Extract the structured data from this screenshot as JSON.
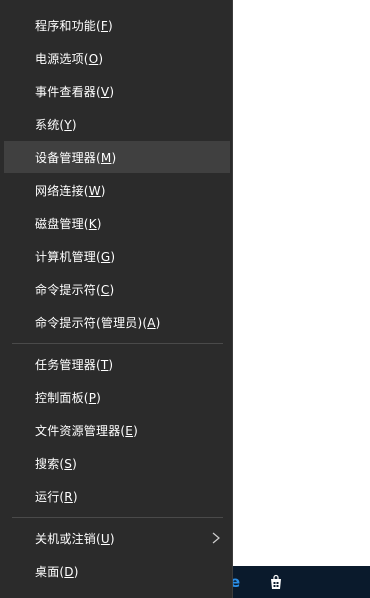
{
  "menu": {
    "items": [
      {
        "label": "程序和功能(F)"
      },
      {
        "label": "电源选项(O)"
      },
      {
        "label": "事件查看器(V)"
      },
      {
        "label": "系统(Y)"
      },
      {
        "label": "设备管理器(M)"
      },
      {
        "label": "网络连接(W)"
      },
      {
        "label": "磁盘管理(K)"
      },
      {
        "label": "计算机管理(G)"
      },
      {
        "label": "命令提示符(C)"
      },
      {
        "label": "命令提示符(管理员)(A)"
      },
      {
        "label": "任务管理器(T)"
      },
      {
        "label": "控制面板(P)"
      },
      {
        "label": "文件资源管理器(E)"
      },
      {
        "label": "搜索(S)"
      },
      {
        "label": "运行(R)"
      },
      {
        "label": "关机或注销(U)"
      },
      {
        "label": "桌面(D)"
      }
    ],
    "highlighted_item": "设备管理器(M)"
  },
  "colors": {
    "menu_background": "#2b2b2b",
    "highlight_background": "#404040",
    "text": "#ffffff",
    "separator": "#4a4a4a",
    "taskbar": "#0a1a2c",
    "edge_accent": "#2b8fe8"
  },
  "icons": {
    "submenu": "chevron-right-icon",
    "taskbar_browser": "edge-icon",
    "taskbar_store": "store-icon"
  }
}
